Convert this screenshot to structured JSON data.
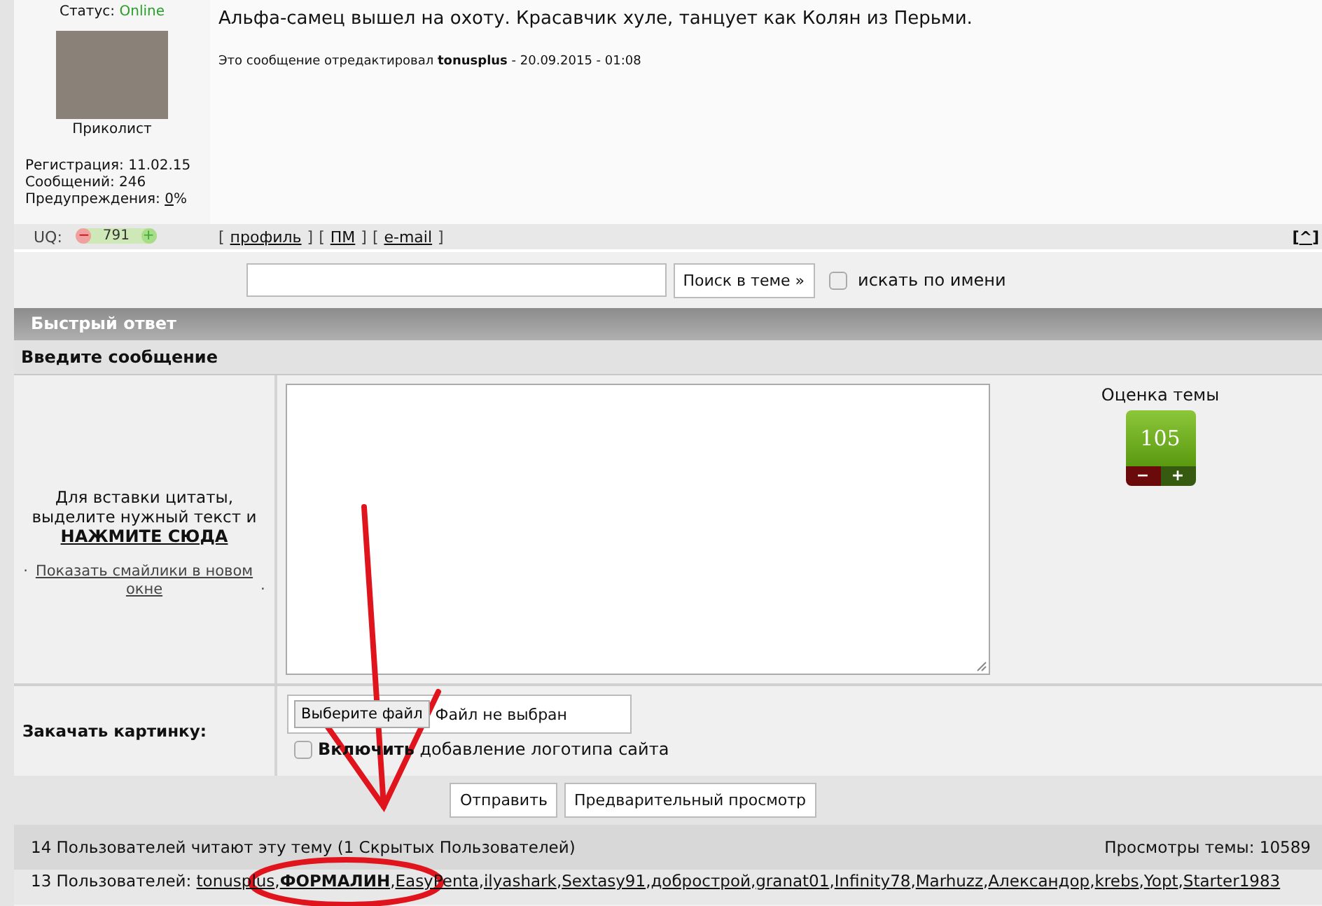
{
  "post": {
    "status_label": "Статус:",
    "status_value": "Online",
    "user_title": "Приколист",
    "stats": [
      {
        "label": "Регистрация:",
        "value": "11.02.15",
        "link": false
      },
      {
        "label": "Сообщений:",
        "value": "246",
        "link": false
      },
      {
        "label": "Предупреждения:",
        "value": "0",
        "suffix": "%",
        "link": true
      }
    ],
    "message": "Альфа-самец вышел на охоту. Красавчик хуле, танцует как Колян из Перьми.",
    "edit_note": "Это сообщение отредактировал **tonusplus** - 20.09.2015 - 01:08",
    "uq_label": "UQ:",
    "uq_minus": "−",
    "uq_value": "791",
    "uq_plus": "+",
    "links": [
      {
        "open": "[",
        "label": "профиль",
        "close": "]"
      },
      {
        "open": "[",
        "label": "ПМ",
        "close": "]"
      },
      {
        "open": "[",
        "label": "e-mail",
        "close": "]"
      }
    ],
    "top_link": {
      "open": "[",
      "label": "^",
      "close": "]"
    }
  },
  "search": {
    "button": "Поиск в теме »",
    "checkbox_label": "искать по имени",
    "checked": false
  },
  "quick_reply": {
    "title": "Быстрый ответ",
    "subtitle": "Введите сообщение",
    "quote_hint": "Для вставки цитаты, выделите нужный текст и",
    "quote_link": "НАЖМИТЕ СЮДА",
    "smilies_before": "·",
    "smilies_link": "Показать смайлики в новом окне",
    "smilies_after": "·",
    "rating_label": "Оценка темы",
    "rating_value": "105",
    "rating_minus": "−",
    "rating_plus": "+",
    "upload_label": "Закачать картинку:",
    "file_button": "Выберите файл",
    "file_status": "Файл не выбран",
    "logo_checkbox_bold": "Включить",
    "logo_checkbox_rest": "добавление логотипа сайта",
    "logo_checked": false,
    "buttons": [
      "Отправить",
      "Предварительный просмотр"
    ]
  },
  "readers": {
    "summary": "14 Пользователей читают эту тему (1 Скрытых Пользователей)",
    "views": "Просмотры темы: 10589",
    "users_label": "13 Пользователей:",
    "users": [
      {
        "name": "tonusplus",
        "bold": false,
        "sep": ","
      },
      {
        "name": "ФОРМАЛИН",
        "bold": true,
        "sep": ","
      },
      {
        "name": "EasyPenta",
        "bold": false,
        "sep": ","
      },
      {
        "name": "ilyashark",
        "bold": false,
        "sep": ","
      },
      {
        "name": "Sextasy91",
        "bold": false,
        "sep": ","
      },
      {
        "name": "добрострой",
        "bold": false,
        "sep": ","
      },
      {
        "name": "granat01",
        "bold": false,
        "sep": ","
      },
      {
        "name": "Infinity78",
        "bold": false,
        "sep": ","
      },
      {
        "name": "Marhuzz",
        "bold": false,
        "sep": ","
      },
      {
        "name": "Александор",
        "bold": false,
        "sep": ","
      },
      {
        "name": "krebs",
        "bold": false,
        "sep": ","
      },
      {
        "name": "Yopt",
        "bold": false,
        "sep": ","
      },
      {
        "name": "Starter1983",
        "bold": false
      }
    ]
  }
}
